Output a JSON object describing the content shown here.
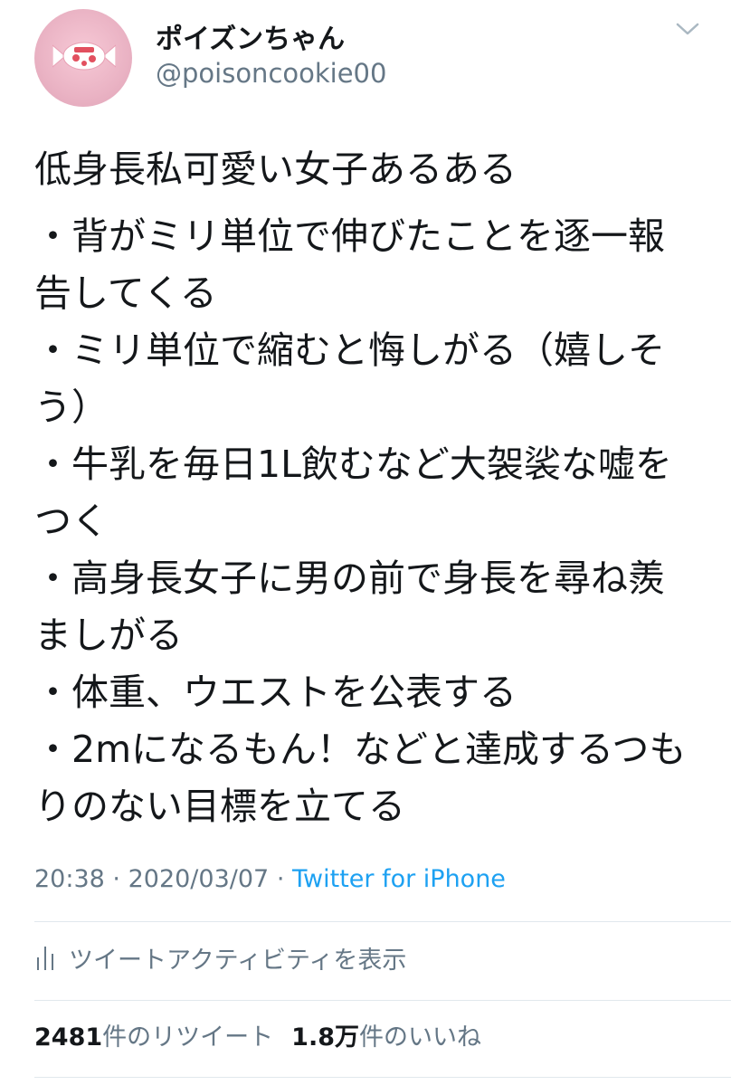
{
  "user": {
    "display_name": "ポイズンちゃん",
    "handle": "@poisoncookie00"
  },
  "tweet": {
    "title": "低身長私可愛い女子あるある",
    "lines": [
      "・背がミリ単位で伸びたことを逐一報",
      "告してくる",
      "・ミリ単位で縮むと悔しがる（嬉しそ",
      "う）",
      "・牛乳を毎日1L飲むなど大袈裟な嘘を",
      "つく",
      "・高身長女子に男の前で身長を尋ね羨",
      "ましがる",
      "・体重、ウエストを公表する",
      "・2mになるもん！などと達成するつも",
      "りのない目標を立てる"
    ],
    "time": "20:38",
    "separator": "·",
    "date": "2020/03/07",
    "source": "Twitter for iPhone"
  },
  "activity": {
    "label": "ツイートアクティビティを表示",
    "icon": "bar-chart-icon"
  },
  "stats": {
    "retweets_count": "2481",
    "retweets_label": "件のリツイート",
    "likes_count": "1.8万",
    "likes_label": "件のいいね"
  },
  "colors": {
    "text": "#14171a",
    "secondary": "#657786",
    "link": "#1da1f2",
    "divider": "#e1e8ed"
  }
}
